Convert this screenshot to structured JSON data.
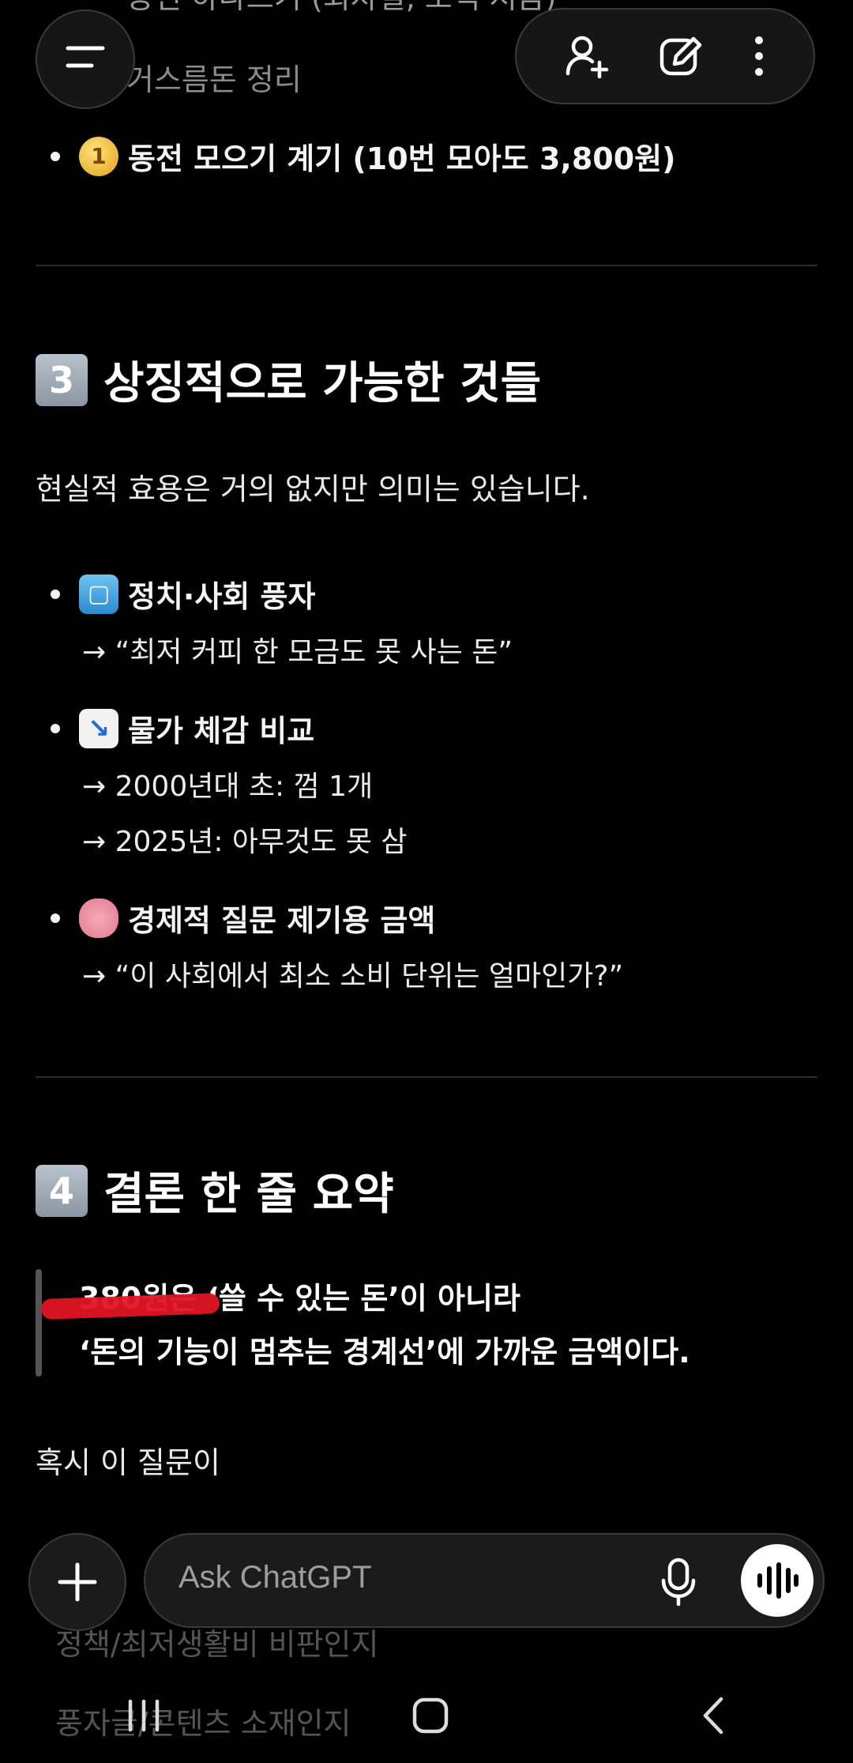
{
  "content": {
    "partial_top_line": "동전 하나쓰기 (회차질, 소액 저금)",
    "partial_second_line": "거스름돈 정리",
    "coin_bullet": {
      "icon": "coin-icon",
      "emoji": "1",
      "text": "동전 모으기 계기 (10번 모아도 3,800원)"
    },
    "section3": {
      "number": "3",
      "title": "상징적으로 가능한 것들",
      "intro": "현실적 효용은 거의 없지만 의미는 있습니다.",
      "items": [
        {
          "icon": "ballot-box-icon",
          "title": "정치·사회 풍자",
          "lines": [
            "→ “최저 커피 한 모금도 못 사는 돈”"
          ]
        },
        {
          "icon": "chart-decreasing-icon",
          "title": "물가 체감 비교",
          "lines": [
            "→ 2000년대 초: 껌 1개",
            "→ 2025년: 아무것도 못 삼"
          ]
        },
        {
          "icon": "brain-icon",
          "title": "경제적 질문 제기용 금액",
          "lines": [
            "→ “이 사회에서 최소 소비 단위는 얼마인가?”"
          ]
        }
      ]
    },
    "section4": {
      "number": "4",
      "title": "결론 한 줄 요약",
      "quote_line1": "380원은 ‘쓸 수 있는 돈’이 아니라",
      "quote_line2": "‘돈의 기능이 멈추는 경계선’에 가까운 금액이다."
    },
    "closing_line": "혹시 이 질문이",
    "faded_lines": [
      "정책/최저생활비 비판인지",
      "풍자글/콘텐츠 소재인지"
    ]
  },
  "composer": {
    "placeholder": "Ask ChatGPT"
  },
  "icons": {
    "menu": "menu-icon",
    "add_person": "add-person-icon",
    "edit": "edit-icon",
    "more": "more-vertical-icon",
    "plus": "plus-icon",
    "mic": "mic-icon",
    "voice": "voice-mode-icon"
  },
  "colors": {
    "background": "#000000",
    "highlight_scribble": "#e01525"
  }
}
